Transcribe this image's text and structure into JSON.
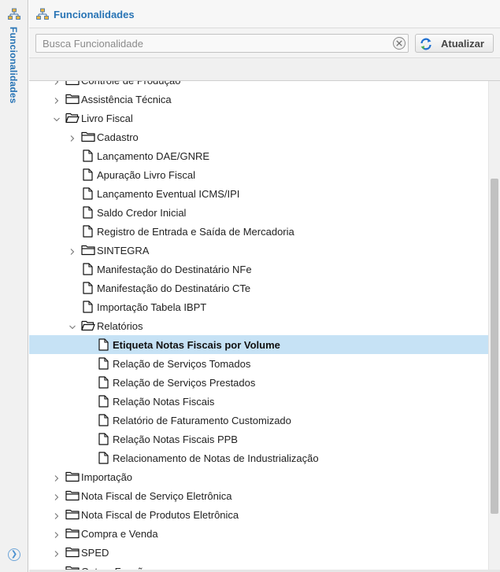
{
  "sidebar": {
    "title": "Funcionalidades",
    "icon": "network-icon",
    "expand_icon": "chevron-right-circle-icon"
  },
  "header": {
    "title": "Funcionalidades",
    "icon": "network-icon"
  },
  "search": {
    "placeholder": "Busca Funcionalidade",
    "value": ""
  },
  "refresh_button": {
    "label": "Atualizar",
    "icon": "refresh-icon"
  },
  "colors": {
    "accent": "#2874b5",
    "selected_row": "#c6e2f5",
    "refresh_blue": "#1e6fd1",
    "refresh_green": "#4caf50"
  },
  "tree": {
    "rows": [
      {
        "label": "Controle de Produção",
        "level": 0,
        "type": "folder",
        "state": "collapsed",
        "partial": true
      },
      {
        "label": "Assistência Técnica",
        "level": 0,
        "type": "folder",
        "state": "collapsed"
      },
      {
        "label": "Livro Fiscal",
        "level": 0,
        "type": "folder",
        "state": "expanded"
      },
      {
        "label": "Cadastro",
        "level": 1,
        "type": "folder",
        "state": "collapsed"
      },
      {
        "label": "Lançamento DAE/GNRE",
        "level": 1,
        "type": "file"
      },
      {
        "label": "Apuração Livro Fiscal",
        "level": 1,
        "type": "file"
      },
      {
        "label": "Lançamento Eventual ICMS/IPI",
        "level": 1,
        "type": "file"
      },
      {
        "label": "Saldo Credor Inicial",
        "level": 1,
        "type": "file"
      },
      {
        "label": "Registro de Entrada e Saída de Mercadoria",
        "level": 1,
        "type": "file"
      },
      {
        "label": "SINTEGRA",
        "level": 1,
        "type": "folder",
        "state": "collapsed"
      },
      {
        "label": "Manifestação do Destinatário NFe",
        "level": 1,
        "type": "file"
      },
      {
        "label": "Manifestação do Destinatário CTe",
        "level": 1,
        "type": "file"
      },
      {
        "label": "Importação Tabela IBPT",
        "level": 1,
        "type": "file"
      },
      {
        "label": "Relatórios",
        "level": 1,
        "type": "folder",
        "state": "expanded"
      },
      {
        "label": "Etiqueta Notas Fiscais por Volume",
        "level": 2,
        "type": "file",
        "selected": true
      },
      {
        "label": "Relação de Serviços Tomados",
        "level": 2,
        "type": "file"
      },
      {
        "label": "Relação de Serviços Prestados",
        "level": 2,
        "type": "file"
      },
      {
        "label": "Relação Notas Fiscais",
        "level": 2,
        "type": "file"
      },
      {
        "label": "Relatório de Faturamento Customizado",
        "level": 2,
        "type": "file"
      },
      {
        "label": "Relação Notas Fiscais PPB",
        "level": 2,
        "type": "file"
      },
      {
        "label": "Relacionamento de Notas de Industrialização",
        "level": 2,
        "type": "file"
      },
      {
        "label": "Importação",
        "level": 0,
        "type": "folder",
        "state": "collapsed"
      },
      {
        "label": "Nota Fiscal de Serviço Eletrônica",
        "level": 0,
        "type": "folder",
        "state": "collapsed"
      },
      {
        "label": "Nota Fiscal de Produtos Eletrônica",
        "level": 0,
        "type": "folder",
        "state": "collapsed"
      },
      {
        "label": "Compra e Venda",
        "level": 0,
        "type": "folder",
        "state": "collapsed"
      },
      {
        "label": "SPED",
        "level": 0,
        "type": "folder",
        "state": "collapsed"
      },
      {
        "label": "Outras Funções",
        "level": 0,
        "type": "folder",
        "state": "collapsed",
        "partial": true
      }
    ]
  }
}
